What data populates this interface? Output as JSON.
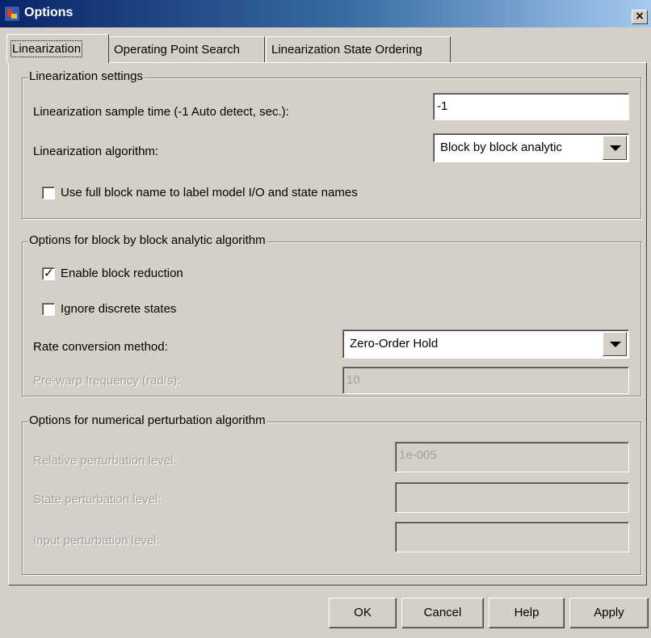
{
  "window": {
    "title": "Options",
    "close_glyph": "×"
  },
  "tabs": [
    {
      "label": "Linearization",
      "active": true
    },
    {
      "label": "Operating Point Search",
      "active": false
    },
    {
      "label": "Linearization State Ordering",
      "active": false
    }
  ],
  "linearization_settings": {
    "legend": "Linearization settings",
    "sample_time_label": "Linearization sample time (-1 Auto detect, sec.):",
    "sample_time_value": "-1",
    "algorithm_label": "Linearization algorithm:",
    "algorithm_value": "Block by block analytic",
    "full_block_name_label": "Use full block name to label model I/O and state names",
    "full_block_name_checked": false
  },
  "block_options": {
    "legend": "Options for block by block analytic algorithm",
    "block_reduction_label": "Enable block reduction",
    "block_reduction_checked": true,
    "ignore_discrete_label": "Ignore discrete states",
    "ignore_discrete_checked": false,
    "rate_conversion_label": "Rate conversion method:",
    "rate_conversion_value": "Zero-Order Hold",
    "prewarp_label": "Pre-warp frequency (rad/s):",
    "prewarp_value": "10"
  },
  "perturbation_options": {
    "legend": "Options for numerical perturbation algorithm",
    "relative_label": "Relative perturbation level:",
    "relative_value": "1e-005",
    "state_label": "State perturbation level:",
    "state_value": "",
    "input_label": "Input perturbation level:",
    "input_value": ""
  },
  "buttons": {
    "ok": "OK",
    "cancel": "Cancel",
    "help": "Help",
    "apply": "Apply"
  }
}
